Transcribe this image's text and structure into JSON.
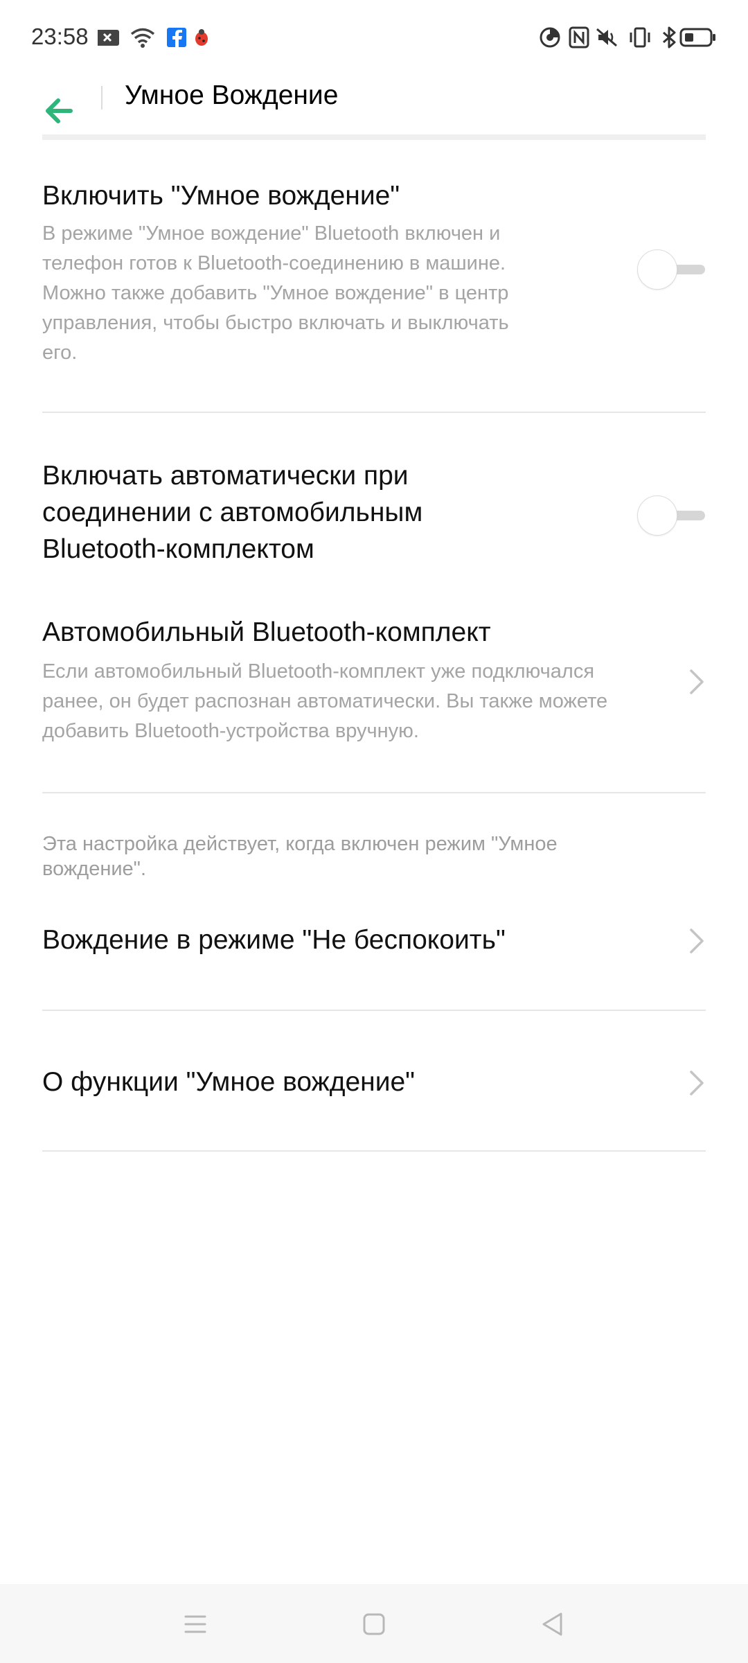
{
  "status_bar": {
    "time": "23:58",
    "left_icons": [
      "notification-x-icon",
      "wifi-icon",
      "facebook-icon",
      "bug-icon"
    ],
    "right_icons": [
      "data-saver-icon",
      "nfc-icon",
      "mute-icon",
      "vibrate-icon",
      "bluetooth-icon",
      "battery-icon"
    ]
  },
  "header": {
    "title": "Умное Вождение",
    "accent_color": "#2db57a"
  },
  "settings": {
    "smart_driving": {
      "title": "Включить \"Умное вождение\"",
      "desc_lines": [
        "В режиме \"Умное вождение\" Bluetooth включен и",
        "телефон готов к Bluetooth-соединению в машине.",
        "Можно также добавить \"Умное вождение\" в центр",
        "управления, чтобы быстро включать и выключать",
        "его."
      ],
      "enabled": false
    },
    "auto_enable": {
      "title_lines": [
        "Включать автоматически при",
        "соединении с автомобильным",
        "Bluetooth-комплектом"
      ],
      "enabled": false
    },
    "car_kit": {
      "title": "Автомобильный Bluetooth-комплект",
      "desc_lines": [
        "Если автомобильный Bluetooth-комплект уже подключался",
        "ранее, он будет распознан автоматически. Вы также можете",
        "добавить Bluetooth-устройства вручную."
      ]
    },
    "note": "Эта настройка действует, когда включен режим \"Умное вождение\".",
    "dnd_driving": {
      "title": "Вождение в режиме \"Не беспокоить\""
    },
    "about": {
      "title": "О функции \"Умное вождение\""
    }
  },
  "nav_bar": {
    "buttons": [
      "menu-icon",
      "home-icon",
      "back-triangle-icon"
    ]
  }
}
